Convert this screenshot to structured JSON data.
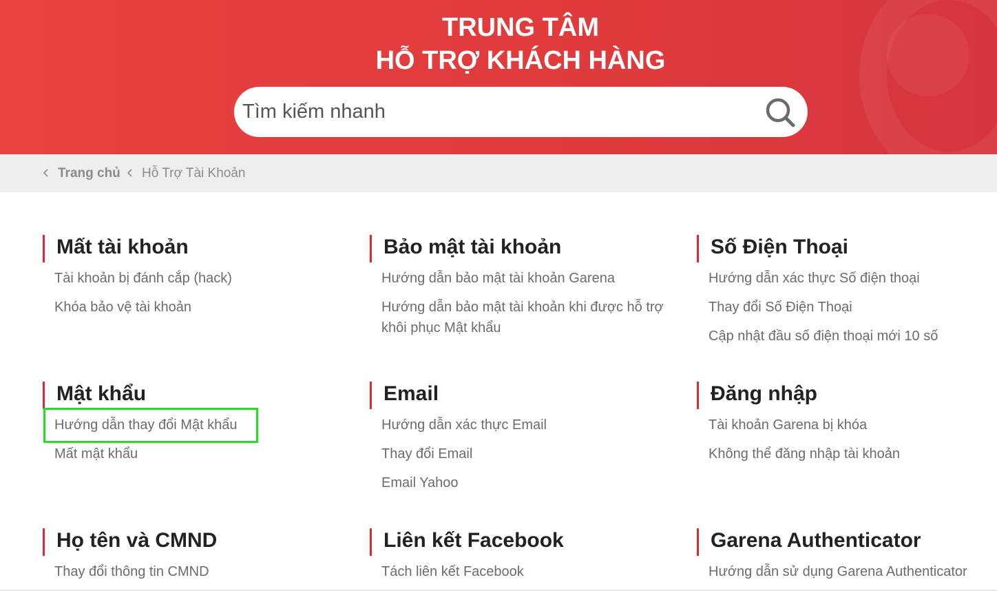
{
  "header": {
    "title_line1": "TRUNG TÂM",
    "title_line2": "HỖ TRỢ KHÁCH HÀNG"
  },
  "search": {
    "placeholder": "Tìm kiếm nhanh",
    "icon": "search-icon"
  },
  "breadcrumb": {
    "home": "Trang chủ",
    "current": "Hỗ Trợ Tài Khoản"
  },
  "sections": [
    {
      "title": "Mất tài khoản",
      "links": [
        "Tài khoản bị đánh cắp (hack)",
        "Khóa bảo vệ tài khoản"
      ]
    },
    {
      "title": "Bảo mật tài khoản",
      "links": [
        "Hướng dẫn bảo mật tài khoản Garena",
        "Hướng dẫn bảo mật tài khoản khi được hỗ trợ khôi phục Mật khẩu"
      ]
    },
    {
      "title": "Số Điện Thoại",
      "links": [
        "Hướng dẫn xác thực Số điện thoại",
        "Thay đổi Số Điện Thoại",
        "Cập nhật đầu số điện thoại mới 10 số"
      ]
    },
    {
      "title": "Mật khẩu",
      "links": [
        "Hướng dẫn thay đổi Mật khẩu",
        "Mất mật khẩu"
      ]
    },
    {
      "title": "Email",
      "links": [
        "Hướng dẫn xác thực Email",
        "Thay đổi Email",
        "Email Yahoo"
      ]
    },
    {
      "title": "Đăng nhập",
      "links": [
        "Tài khoản Garena bị khóa",
        "Không thể đăng nhập tài khoản"
      ]
    },
    {
      "title": "Họ tên và CMND",
      "links": [
        "Thay đổi thông tin CMND"
      ]
    },
    {
      "title": "Liên kết Facebook",
      "links": [
        "Tách liên kết Facebook"
      ]
    },
    {
      "title": "Garena Authenticator",
      "links": [
        "Hướng dẫn sử dụng Garena Authenticator"
      ]
    }
  ],
  "colors": {
    "header_bg": "#e23e3e",
    "accent": "#e0262f",
    "highlight": "#22dd22"
  }
}
